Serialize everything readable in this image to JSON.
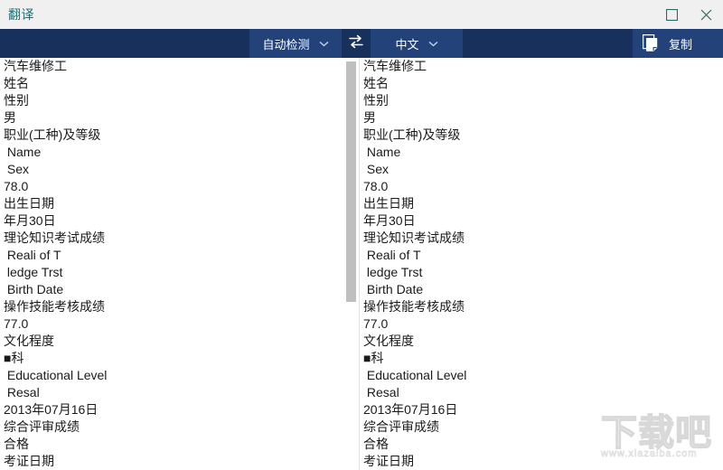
{
  "window": {
    "title": "翻译",
    "controls": [
      {
        "name": "maximize-button",
        "icon": "square-icon"
      },
      {
        "name": "close-button",
        "icon": "close-icon"
      }
    ]
  },
  "toolbar": {
    "source_language": "自动检测",
    "target_language": "中文",
    "swap_icon": "swap-arrows-icon",
    "copy_label": "复制",
    "copy_icon": "copy-icon",
    "caret_icon": "chevron-down-icon",
    "accent_bg": "#17305c",
    "accent_btn_bg": "#23427a"
  },
  "source_pane": {
    "lines": [
      "汽车维修工",
      "姓名",
      "性别",
      "男",
      "职业(工种)及等级",
      " Name",
      " Sex",
      "78.0",
      "出生日期",
      "年月30日",
      "理论知识考试成绩",
      " Reali of T",
      " ledge Trst",
      " Birth Date",
      "操作技能考核成绩",
      "77.0",
      "文化程度",
      "■科",
      " Educational Level",
      " Resal",
      "2013年07月16日",
      "综合评审成绩",
      "合格",
      "考证日期"
    ]
  },
  "target_pane": {
    "lines": [
      "汽车维修工",
      "姓名",
      "性别",
      "男",
      "职业(工种)及等级",
      " Name",
      " Sex",
      "78.0",
      "出生日期",
      "年月30日",
      "理论知识考试成绩",
      " Reali of T",
      " ledge Trst",
      " Birth Date",
      "操作技能考核成绩",
      "77.0",
      "文化程度",
      "■科",
      " Educational Level",
      " Resal",
      "2013年07月16日",
      "综合评审成绩",
      "合格",
      "考证日期"
    ]
  },
  "watermark": {
    "text": "下载吧",
    "url": "www.xiazaiba.com"
  }
}
